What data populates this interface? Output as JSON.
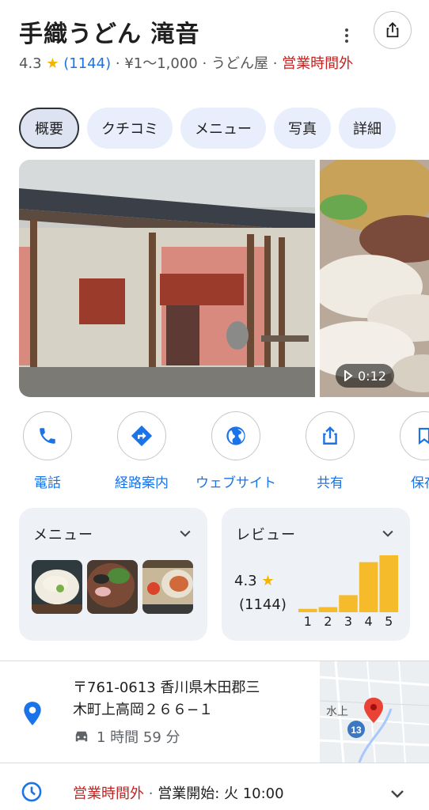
{
  "place": {
    "name": "手織うどん 滝音",
    "rating": "4.3",
    "star": "★",
    "review_count": "(1144)",
    "price": "¥1～1,000",
    "category": "うどん屋",
    "status": "営業時間外",
    "separator": "·"
  },
  "header": {
    "more_icon": "more-vert-icon",
    "share_icon": "share-icon"
  },
  "tabs": [
    {
      "label": "概要",
      "active": true
    },
    {
      "label": "クチコミ",
      "active": false
    },
    {
      "label": "メニュー",
      "active": false
    },
    {
      "label": "写真",
      "active": false
    },
    {
      "label": "詳細",
      "active": false
    }
  ],
  "photos": {
    "video_duration": "0:12"
  },
  "actions": [
    {
      "label": "電話",
      "icon": "phone-icon"
    },
    {
      "label": "経路案内",
      "icon": "directions-icon"
    },
    {
      "label": "ウェブサイト",
      "icon": "globe-icon"
    },
    {
      "label": "共有",
      "icon": "share-icon"
    },
    {
      "label": "保存",
      "icon": "bookmark-icon"
    }
  ],
  "menu_card": {
    "title": "メニュー"
  },
  "review_card": {
    "title": "レビュー",
    "score": "4.3",
    "count": "(1144)",
    "distribution": [
      {
        "stars": "1",
        "level": 0.06
      },
      {
        "stars": "2",
        "level": 0.09
      },
      {
        "stars": "3",
        "level": 0.3
      },
      {
        "stars": "4",
        "level": 0.88
      },
      {
        "stars": "5",
        "level": 1.0
      }
    ]
  },
  "address": {
    "line1": "〒761-0613 香川県木田郡三",
    "line2": "木町上高岡２６６−１",
    "drive_time": "1 時間 59 分",
    "map_road_number": "13",
    "map_label": "水上"
  },
  "hours": {
    "status": "営業時間外",
    "next_open": "営業開始: 火 10:00"
  },
  "colors": {
    "accent": "#1a73e8",
    "closed": "#c5221f",
    "star": "#f4b400",
    "bar": "#f6bb2b"
  }
}
